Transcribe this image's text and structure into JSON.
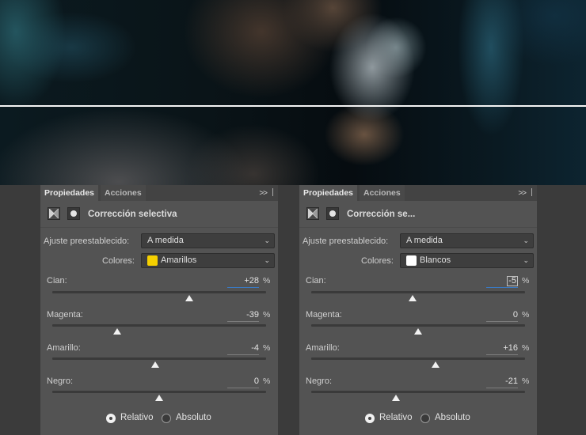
{
  "photo": {
    "icon": "portrait-photo"
  },
  "panels": [
    {
      "tabs": {
        "active": "Propiedades",
        "inactive": "Acciones",
        "menu": ">>"
      },
      "title": "Corrección selectiva",
      "preset": {
        "label": "Ajuste preestablecido:",
        "value": "A medida"
      },
      "colors": {
        "label": "Colores:",
        "value": "Amarillos",
        "swatch": "#f5d000"
      },
      "sliders": [
        {
          "label": "Cian:",
          "value": "+28",
          "level": 0.64
        },
        {
          "label": "Magenta:",
          "value": "-39",
          "level": 0.305
        },
        {
          "label": "Amarillo:",
          "value": "-4",
          "level": 0.48
        },
        {
          "label": "Negro:",
          "value": "0",
          "level": 0.5
        }
      ],
      "modes": {
        "relative": "Relativo",
        "absolute": "Absoluto",
        "selected": "relative"
      }
    },
    {
      "tabs": {
        "active": "Propiedades",
        "inactive": "Acciones",
        "menu": ">>"
      },
      "title": "Corrección se...",
      "preset": {
        "label": "Ajuste preestablecido:",
        "value": "A medida"
      },
      "colors": {
        "label": "Colores:",
        "value": "Blancos",
        "swatch": "#ffffff"
      },
      "sliders": [
        {
          "label": "Cian:",
          "value": "-5",
          "level": 0.475
        },
        {
          "label": "Magenta:",
          "value": "0",
          "level": 0.5
        },
        {
          "label": "Amarillo:",
          "value": "+16",
          "level": 0.58
        },
        {
          "label": "Negro:",
          "value": "-21",
          "level": 0.395
        }
      ],
      "modes": {
        "relative": "Relativo",
        "absolute": "Absoluto",
        "selected": "relative"
      }
    }
  ]
}
